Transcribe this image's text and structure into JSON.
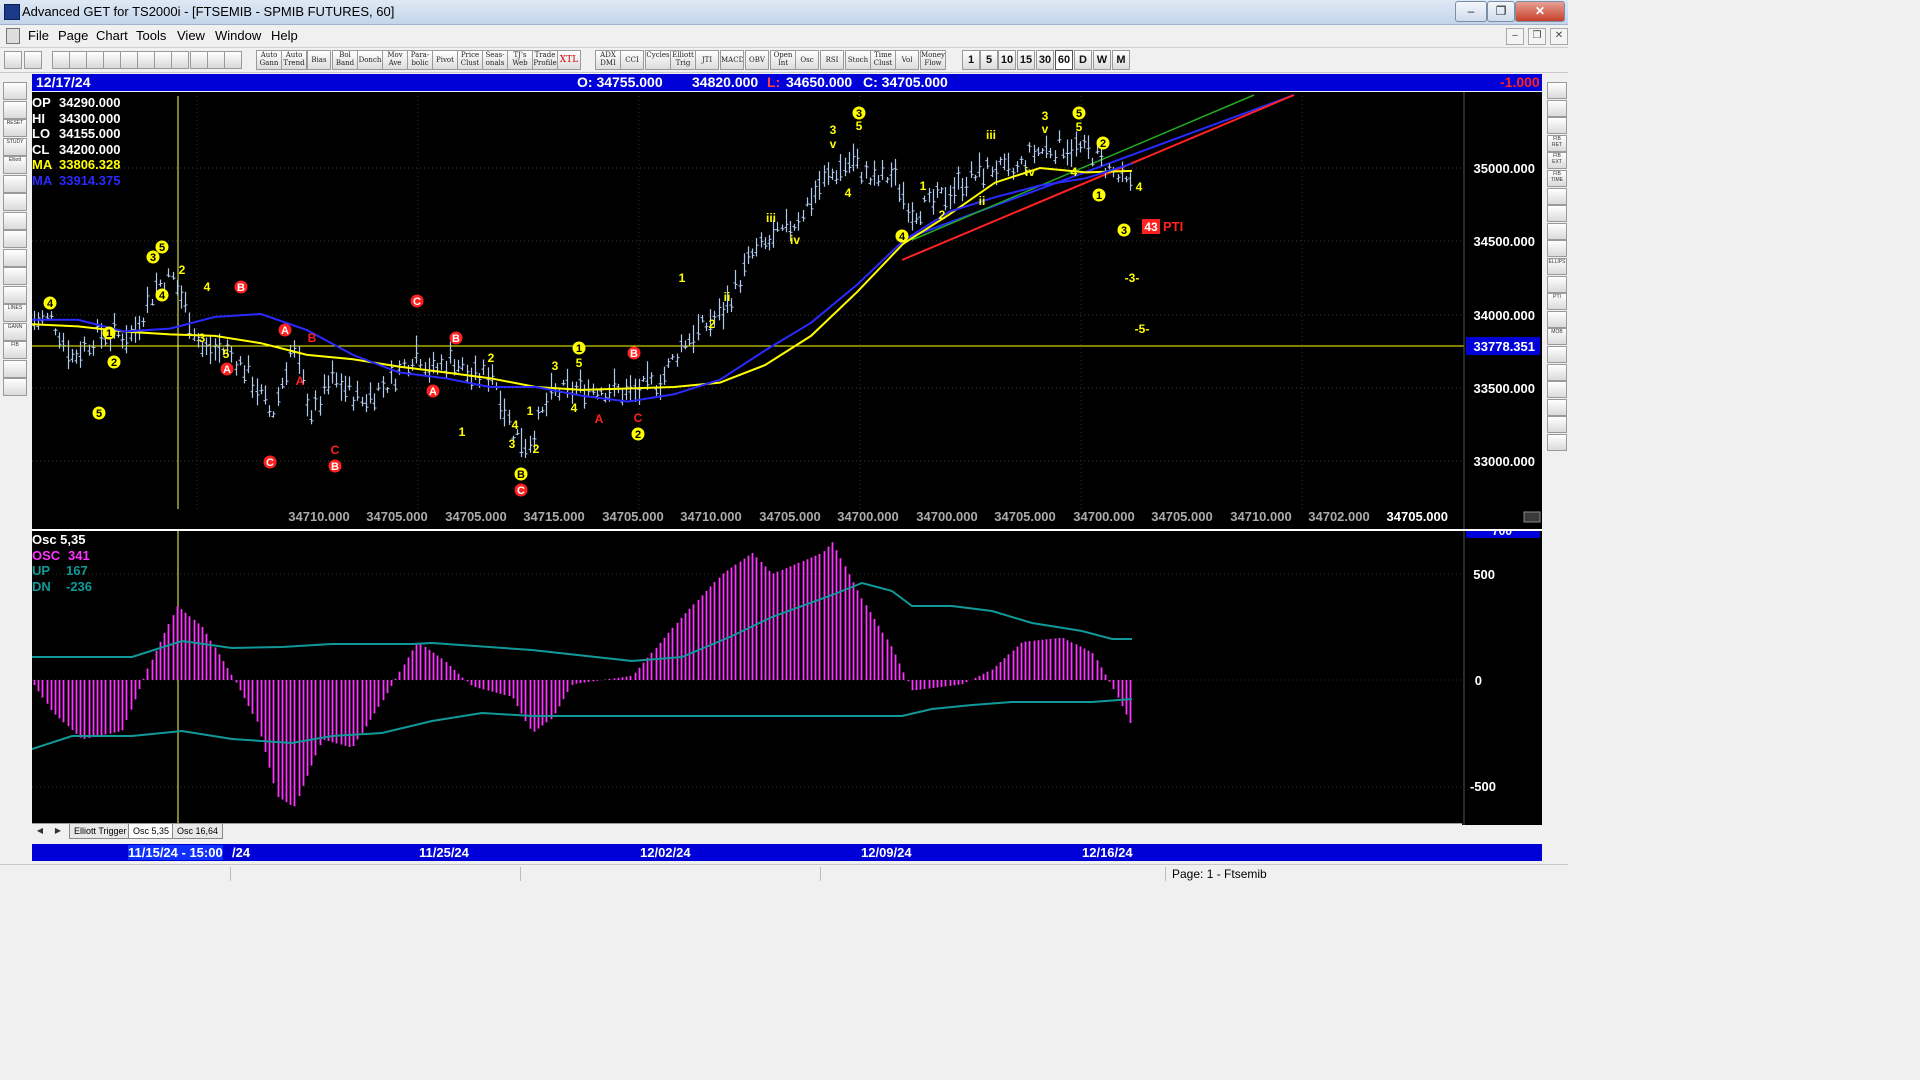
{
  "window": {
    "title": "Advanced GET for TS2000i - [FTSEMIB - SPMIB FUTURES, 60]",
    "btn_min": "‒",
    "btn_max": "❐",
    "btn_close": "✕"
  },
  "menu": [
    "File",
    "Page",
    "Chart",
    "Tools",
    "View",
    "Window",
    "Help"
  ],
  "toolbar": {
    "study_buttons": [
      "Auto Gann",
      "Auto Trend",
      "Bias",
      "Bol Band",
      "Donch",
      "Mov Ave",
      "Para-bolic",
      "Pivot",
      "Price Clust",
      "Seas-onals",
      "TJ's Web",
      "Trade Profile",
      "XTL",
      "ADX DMI",
      "CCI",
      "Cycles",
      "Elliott Trig",
      "JTI",
      "MACD",
      "OBV",
      "Open Int",
      "Osc",
      "RSI",
      "Stoch",
      "Time Clust",
      "Vol",
      "Money Flow"
    ],
    "intervals": [
      "1",
      "5",
      "10",
      "15",
      "30",
      "60",
      "D",
      "W",
      "M"
    ]
  },
  "left_tools": [
    "",
    "",
    "RESET",
    "STUDY",
    "Elliott",
    "",
    "",
    "",
    "",
    "",
    "",
    "",
    "LINES",
    "GANN",
    "FIB",
    "",
    ""
  ],
  "right_tools": [
    "",
    "",
    "",
    "FIB RET",
    "FIB EXT",
    "FIB TIME",
    "",
    "",
    "",
    "",
    "ELLIPS",
    "",
    "PTI",
    "",
    "MOB",
    "",
    "",
    "",
    "",
    "",
    ""
  ],
  "infobar": {
    "date": "12/17/24",
    "open": "O: 34755.000",
    "high": "34820.000",
    "low_label": "L:",
    "low": "34650.000",
    "close": "C: 34705.000",
    "change": "-1.000"
  },
  "readout": [
    {
      "label": "OP",
      "value": "34290.000",
      "color": "#ffffff"
    },
    {
      "label": "HI",
      "value": "34300.000",
      "color": "#ffffff"
    },
    {
      "label": "LO",
      "value": "34155.000",
      "color": "#ffffff"
    },
    {
      "label": "CL",
      "value": "34200.000",
      "color": "#ffffff"
    },
    {
      "label": "MA",
      "value": "33806.328",
      "color": "#ffff00"
    },
    {
      "label": "MA",
      "value": "33914.375",
      "color": "#2a2aff"
    }
  ],
  "price_axis": {
    "ticks": [
      "35000.000",
      "34500.000",
      "34000.000",
      "33500.000",
      "33000.000"
    ],
    "current_tag": "33778.351",
    "bottom_labels": [
      "34710.000",
      "34705.000",
      "34705.000",
      "34715.000",
      "34705.000",
      "34710.000",
      "34705.000",
      "34700.000",
      "34700.000",
      "34705.000",
      "34700.000",
      "34705.000",
      "34710.000",
      "34702.000"
    ],
    "bottom_last": "34705.000"
  },
  "elliott": {
    "pti_value": "43",
    "pti_label": "PTI",
    "proj3": "-3-",
    "proj5": "-5-"
  },
  "osc": {
    "title": "Osc 5,35",
    "osc": {
      "label": "OSC",
      "value": "341",
      "color": "#ff33ff"
    },
    "up": {
      "label": "UP",
      "value": "167",
      "color": "#119999"
    },
    "dn": {
      "label": "DN",
      "value": "-236",
      "color": "#119999"
    },
    "axis": [
      "700",
      "500",
      "0",
      "-500"
    ]
  },
  "tabs": [
    "Elliott Trigger",
    "Osc 5,35",
    "Osc 16,64"
  ],
  "dates": {
    "cursor": "11/15/24 - 15:00",
    "cursor_tail": "/24",
    "labels": [
      "11/25/24",
      "12/02/24",
      "12/09/24",
      "12/16/24"
    ]
  },
  "status": "Page: 1 - Ftsemib",
  "colors": {
    "up_bar": "#aec8ee",
    "ma_fast": "#ffff00",
    "ma_slow": "#2a2aff",
    "osc_hist": "#ff33ff",
    "bands": "#119999",
    "channel_blue": "#2a2aff",
    "channel_green": "#22aa22",
    "channel_red": "#ff2222"
  },
  "chart_data": {
    "type": "line",
    "title": "",
    "series": [
      {
        "name": "MA",
        "values": [
          33930,
          33915,
          33880,
          33860,
          33850,
          33800,
          33720,
          33690,
          33640,
          33600,
          33560,
          33500,
          33480,
          33490,
          33500,
          33530,
          33650,
          33850,
          34150,
          34480,
          34680,
          34900,
          35000,
          34970,
          34980
        ]
      },
      {
        "name": "MA",
        "values": [
          33960,
          33960,
          33880,
          33900,
          33980,
          34000,
          33890,
          33720,
          33600,
          33560,
          33500,
          33500,
          33440,
          33400,
          33450,
          33550,
          33750,
          33940,
          34200,
          34500,
          34700,
          34800,
          34880,
          34930,
          35030
        ]
      }
    ],
    "ylim": [
      32780,
      35560
    ]
  }
}
